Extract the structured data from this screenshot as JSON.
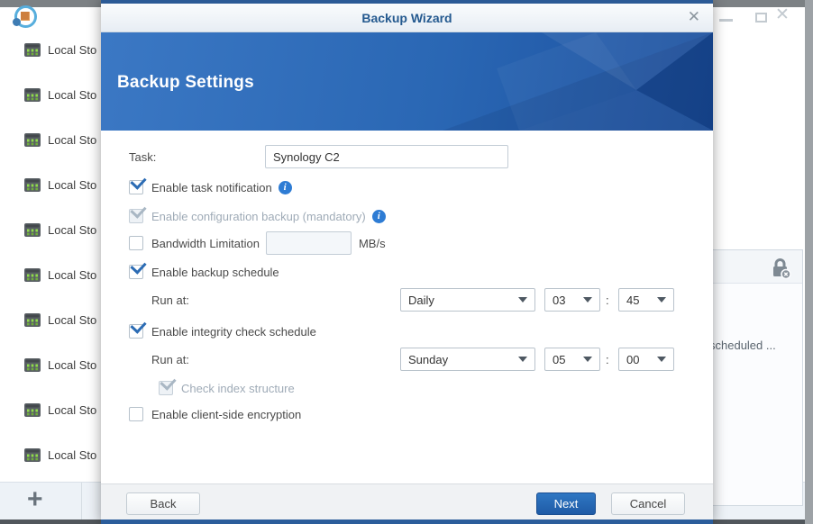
{
  "colors": {
    "accent": "#2a6cb5",
    "banner_start": "#3b78c4",
    "banner_end": "#1b4f9e",
    "check": "#2c6cb4"
  },
  "background": {
    "sidebar_items": [
      "Local Sto",
      "Local Sto",
      "Local Sto",
      "Local Sto",
      "Local Sto",
      "Local Sto",
      "Local Sto",
      "Local Sto",
      "Local Sto",
      "Local Sto"
    ],
    "add_label": "+",
    "right_panel": {
      "snippet": "scheduled ..."
    },
    "window_close_glyph": "✕"
  },
  "dialog": {
    "title": "Backup Wizard",
    "close_glyph": "✕",
    "heading": "Backup Settings",
    "task": {
      "label": "Task:",
      "value": "Synology C2"
    },
    "options": {
      "notification": {
        "label": "Enable task notification"
      },
      "config_backup": {
        "label": "Enable configuration backup (mandatory)"
      },
      "bandwidth": {
        "label": "Bandwidth Limitation",
        "value": "",
        "unit": "MB/s"
      },
      "backup_schedule": {
        "label": "Enable backup schedule",
        "run_at": "Run at:",
        "frequency": "Daily",
        "hour": "03",
        "colon": ":",
        "minute": "45"
      },
      "integrity_schedule": {
        "label": "Enable integrity check schedule",
        "run_at": "Run at:",
        "frequency": "Sunday",
        "hour": "05",
        "colon": ":",
        "minute": "00"
      },
      "check_index": {
        "label": "Check index structure"
      },
      "encryption": {
        "label": "Enable client-side encryption"
      }
    },
    "footer": {
      "back": "Back",
      "next": "Next",
      "cancel": "Cancel"
    }
  }
}
